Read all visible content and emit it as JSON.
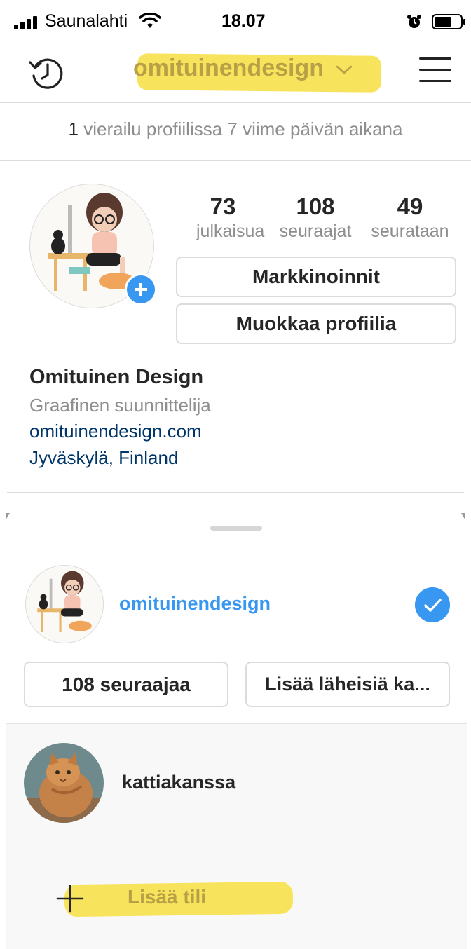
{
  "status_bar": {
    "carrier": "Saunalahti",
    "time": "18.07",
    "icons": [
      "signal-icon",
      "wifi-icon",
      "alarm-icon",
      "battery-icon"
    ]
  },
  "header": {
    "username": "omituinendesign",
    "icons": [
      "history-icon",
      "chevron-down-icon",
      "menu-icon"
    ]
  },
  "visits": {
    "count": "1",
    "text": "vierailu profiilissa 7 viime päivän aikana"
  },
  "profile": {
    "stats": [
      {
        "value": "73",
        "label": "julkaisua"
      },
      {
        "value": "108",
        "label": "seuraajat"
      },
      {
        "value": "49",
        "label": "seurataan"
      }
    ],
    "buttons": {
      "promotions": "Markkinoinnit",
      "edit": "Muokkaa profiilia"
    },
    "bio": {
      "name": "Omituinen Design",
      "category": "Graafinen suunnittelija",
      "website": "omituinendesign.com",
      "location": "Jyväskylä, Finland"
    }
  },
  "account_switcher": {
    "current_account": {
      "username": "omituinendesign",
      "selected": true
    },
    "buttons": {
      "followers": "108 seuraajaa",
      "close_friends": "Lisää läheisiä ka..."
    },
    "other_account": {
      "username": "kattiakanssa"
    },
    "add_account": "Lisää tili"
  },
  "colors": {
    "accent_blue": "#3897f0",
    "link_blue": "#003569",
    "highlight_yellow": "#f7e04a",
    "muted_text": "#8e8e8e"
  }
}
